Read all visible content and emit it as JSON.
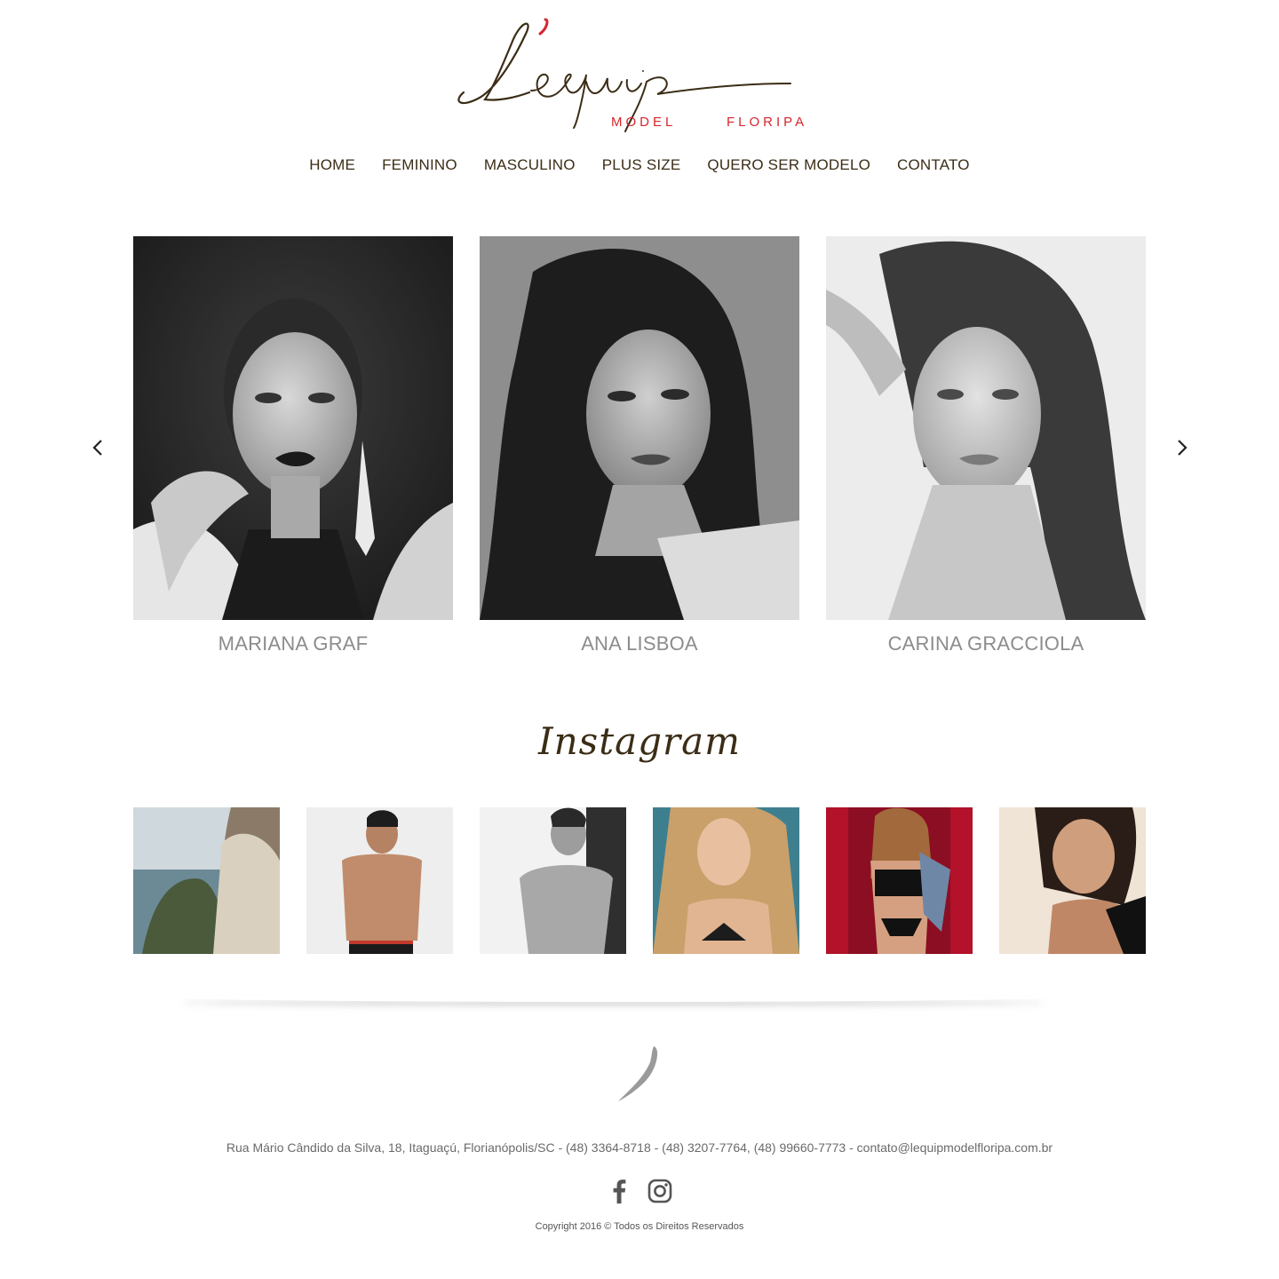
{
  "brand": {
    "logo_script": "L'equip",
    "logo_word_1": "MODEL",
    "logo_word_2": "FLORIPA",
    "accent_color": "#d7262d",
    "text_color": "#3b2d16"
  },
  "nav": {
    "items": [
      {
        "label": "HOME"
      },
      {
        "label": "FEMININO"
      },
      {
        "label": "MASCULINO"
      },
      {
        "label": "PLUS SIZE"
      },
      {
        "label": "QUERO SER MODELO"
      },
      {
        "label": "CONTATO"
      }
    ]
  },
  "carousel": {
    "prev_icon": "chevron-left-icon",
    "next_icon": "chevron-right-icon",
    "models": [
      {
        "name": "MARIANA GRAF"
      },
      {
        "name": "ANA LISBOA"
      },
      {
        "name": "CARINA GRACCIOLA"
      }
    ]
  },
  "instagram": {
    "title": "Instagram",
    "tiles": [
      {
        "icon": "photo-woman-coast"
      },
      {
        "icon": "photo-man-shirtless-smiling"
      },
      {
        "icon": "photo-man-shirtless-bw"
      },
      {
        "icon": "photo-woman-beach"
      },
      {
        "icon": "photo-woman-red-background"
      },
      {
        "icon": "photo-woman-sand"
      }
    ]
  },
  "footer": {
    "address": "Rua Mário Cândido da Silva, 18, Itaguaçú, Florianópolis/SC - (48) 3364-8718 - (48) 3207-7764, (48) 99660-7773 - contato@lequipmodelfloripa.com.br",
    "social": [
      {
        "icon": "facebook-icon"
      },
      {
        "icon": "instagram-icon"
      }
    ],
    "copyright": "Copyright 2016 © Todos os Direitos Reservados"
  }
}
